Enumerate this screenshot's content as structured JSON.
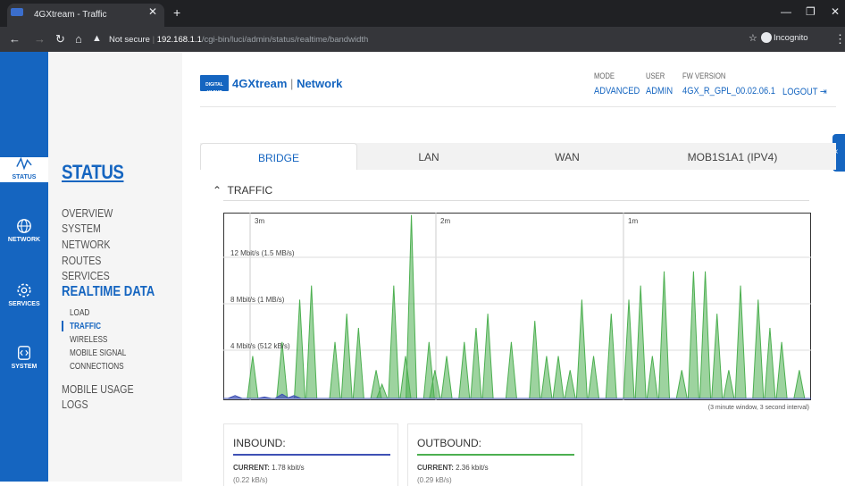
{
  "browser": {
    "tab_title": "4GXtream - Traffic",
    "url_security": "Not secure",
    "url_host": "192.168.1.1",
    "url_path": "/cgi-bin/luci/admin/status/realtime/bandwidth",
    "incognito_label": "Incognito"
  },
  "rail": [
    {
      "label": "STATUS",
      "icon": "activity-icon"
    },
    {
      "label": "NETWORK",
      "icon": "globe-icon"
    },
    {
      "label": "SERVICES",
      "icon": "gear-icon"
    },
    {
      "label": "SYSTEM",
      "icon": "code-icon"
    }
  ],
  "sidebar": {
    "title": "STATUS",
    "items": [
      "OVERVIEW",
      "SYSTEM",
      "NETWORK",
      "ROUTES",
      "SERVICES"
    ],
    "active_group": "REALTIME DATA",
    "sub_items": [
      "LOAD",
      "TRAFFIC",
      "WIRELESS",
      "MOBILE SIGNAL",
      "CONNECTIONS"
    ],
    "after_items": [
      "MOBILE USAGE",
      "LOGS"
    ]
  },
  "header": {
    "logo_badge": "DIGITAL YACHT",
    "brand": "4GXtream",
    "section": "Network",
    "mode_label": "MODE",
    "mode_value": "ADVANCED",
    "user_label": "USER",
    "user_value": "ADMIN",
    "fw_label": "FW VERSION",
    "fw_value": "4GX_R_GPL_00.02.06.1",
    "logout": "LOGOUT"
  },
  "tabs": [
    "BRIDGE",
    "LAN",
    "WAN",
    "MOB1S1A1 (IPV4)"
  ],
  "traffic_title": "TRAFFIC",
  "chart_data": {
    "type": "area",
    "time_labels": [
      "3m",
      "2m",
      "1m"
    ],
    "y_labels": [
      "12 Mbit/s (1.5 MB/s)",
      "8 Mbit/s (1 MB/s)",
      "4 Mbit/s (512 kB/s)"
    ],
    "note": "(3 minute window, 3 second interval)",
    "series": [
      {
        "color": "#4caf50",
        "peaks": [
          [
            0.05,
            0.3
          ],
          [
            0.1,
            0.4
          ],
          [
            0.13,
            0.7
          ],
          [
            0.15,
            0.8
          ],
          [
            0.19,
            0.4
          ],
          [
            0.21,
            0.6
          ],
          [
            0.23,
            0.5
          ],
          [
            0.26,
            0.2
          ],
          [
            0.27,
            0.1
          ],
          [
            0.29,
            0.8
          ],
          [
            0.31,
            0.3
          ],
          [
            0.32,
            1.3
          ],
          [
            0.35,
            0.4
          ],
          [
            0.36,
            0.2
          ],
          [
            0.38,
            0.3
          ],
          [
            0.41,
            0.4
          ],
          [
            0.43,
            0.5
          ],
          [
            0.45,
            0.6
          ],
          [
            0.49,
            0.4
          ],
          [
            0.53,
            0.55
          ],
          [
            0.55,
            0.3
          ],
          [
            0.57,
            0.3
          ],
          [
            0.59,
            0.2
          ],
          [
            0.61,
            0.7
          ],
          [
            0.63,
            0.3
          ],
          [
            0.66,
            0.6
          ],
          [
            0.69,
            0.7
          ],
          [
            0.71,
            0.8
          ],
          [
            0.73,
            0.3
          ],
          [
            0.75,
            0.9
          ],
          [
            0.78,
            0.2
          ],
          [
            0.8,
            0.9
          ],
          [
            0.82,
            0.9
          ],
          [
            0.84,
            0.6
          ],
          [
            0.86,
            0.2
          ],
          [
            0.88,
            0.8
          ],
          [
            0.91,
            0.7
          ],
          [
            0.93,
            0.5
          ],
          [
            0.95,
            0.4
          ],
          [
            0.98,
            0.2
          ]
        ]
      },
      {
        "color": "#3f51b5",
        "peaks": [
          [
            0.02,
            0.02
          ],
          [
            0.07,
            0.01
          ],
          [
            0.1,
            0.03
          ],
          [
            0.12,
            0.02
          ]
        ]
      }
    ]
  },
  "cards": {
    "inbound": {
      "title": "INBOUND:",
      "current_label": "CURRENT:",
      "current_value": "1.78 kbit/s",
      "sub": "(0.22 kB/s)",
      "color": "#3f51b5"
    },
    "outbound": {
      "title": "OUTBOUND:",
      "current_label": "CURRENT:",
      "current_value": "2.36 kbit/s",
      "sub": "(0.29 kB/s)",
      "color": "#4caf50"
    }
  }
}
